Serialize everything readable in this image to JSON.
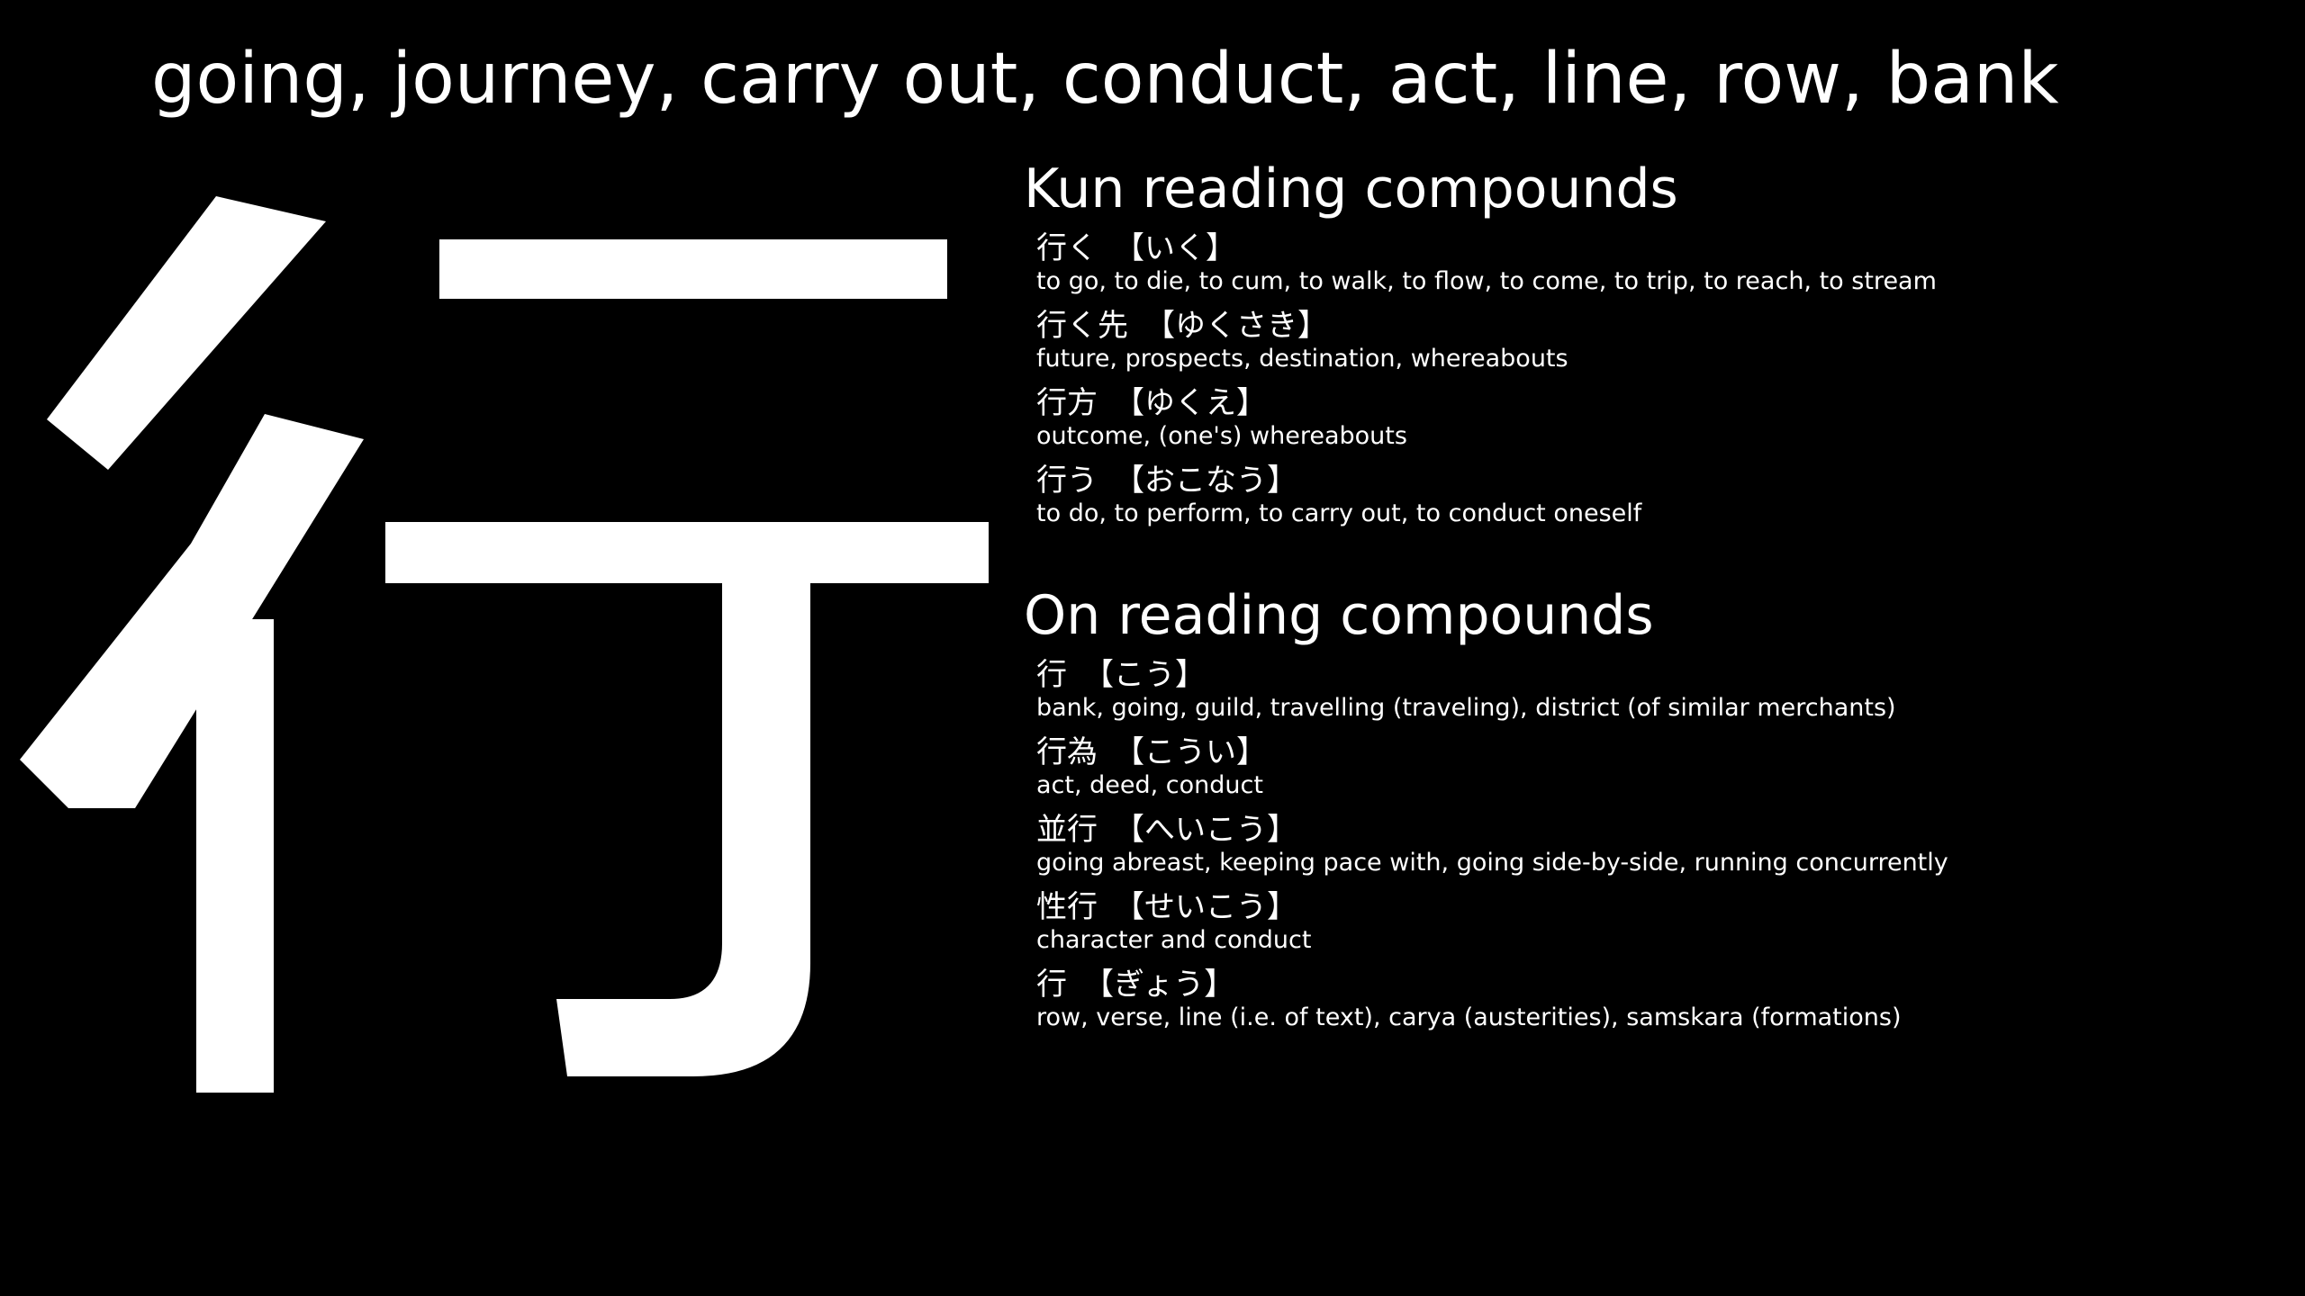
{
  "meaning": "going, journey, carry out, conduct, act, line, row, bank",
  "kanji": "行",
  "kun": {
    "heading": "Kun reading compounds",
    "entries": [
      {
        "word": "行く",
        "reading": "【いく】",
        "gloss": "to go, to die, to cum, to walk, to flow, to come, to trip, to reach, to stream"
      },
      {
        "word": "行く先",
        "reading": "【ゆくさき】",
        "gloss": "future, prospects, destination, whereabouts"
      },
      {
        "word": "行方",
        "reading": "【ゆくえ】",
        "gloss": "outcome, (one's) whereabouts"
      },
      {
        "word": "行う",
        "reading": "【おこなう】",
        "gloss": "to do, to perform, to carry out, to conduct oneself"
      }
    ]
  },
  "on": {
    "heading": "On reading compounds",
    "entries": [
      {
        "word": "行",
        "reading": "【こう】",
        "gloss": "bank, going, guild, travelling (traveling), district (of similar merchants)"
      },
      {
        "word": "行為",
        "reading": "【こうい】",
        "gloss": "act, deed, conduct"
      },
      {
        "word": "並行",
        "reading": "【へいこう】",
        "gloss": "going abreast, keeping pace with, going side-by-side, running concurrently"
      },
      {
        "word": "性行",
        "reading": "【せいこう】",
        "gloss": "character and conduct"
      },
      {
        "word": "行",
        "reading": "【ぎょう】",
        "gloss": "row, verse, line (i.e. of text), carya (austerities), samskara (formations)"
      }
    ]
  },
  "colors": {
    "background": "#000000",
    "text": "#ffffff"
  }
}
